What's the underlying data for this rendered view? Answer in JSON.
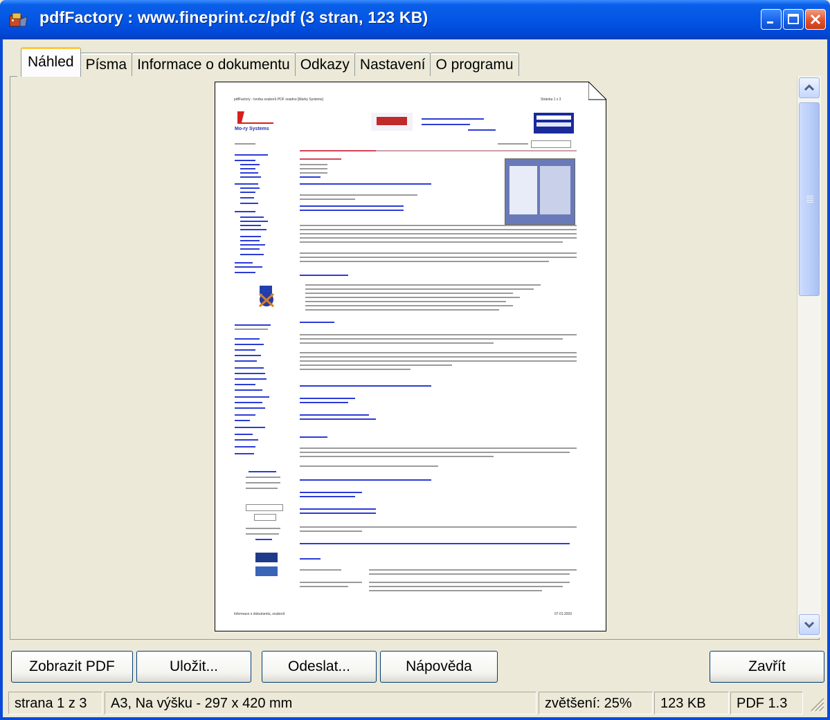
{
  "window": {
    "title": "pdfFactory : www.fineprint.cz/pdf (3 stran, 123 KB)",
    "icon": "pdffactory-app-icon",
    "controls": [
      "minimize-icon",
      "maximize-icon",
      "close-icon"
    ]
  },
  "tabs": [
    {
      "label": "Náhled",
      "active": true
    },
    {
      "label": "Písma",
      "active": false
    },
    {
      "label": "Informace o dokumentu",
      "active": false
    },
    {
      "label": "Odkazy",
      "active": false
    },
    {
      "label": "Nastavení",
      "active": false
    },
    {
      "label": "O programu",
      "active": false
    }
  ],
  "preview": {
    "page_header_left": "pdfFactory - tvorba souborů PDF snadno [Marky Systems]",
    "page_header_right": "Stránka 1 z 3",
    "company": "Mo-ry Systems",
    "footer_left": "Informace o dokumentu, souborů",
    "footer_right": "07.01.2003",
    "section_title": "pdfFactory Pro verze 2.0 - Nová verze",
    "scroll_position": 0.0
  },
  "buttons": {
    "show_pdf": "Zobrazit PDF",
    "save": "Uložit...",
    "send": "Odeslat...",
    "help": "Nápověda",
    "close": "Zavřít"
  },
  "status": {
    "page": "strana 1 z 3",
    "format": "A3, Na výšku - 297 x 420 mm",
    "zoom": "zvětšení: 25%",
    "size": "123 KB",
    "version": "PDF 1.3"
  },
  "colors": {
    "titlebar": "#0456e4",
    "tab_highlight": "#ffc83c",
    "face": "#ece9d8",
    "close_button": "#e0522d"
  }
}
